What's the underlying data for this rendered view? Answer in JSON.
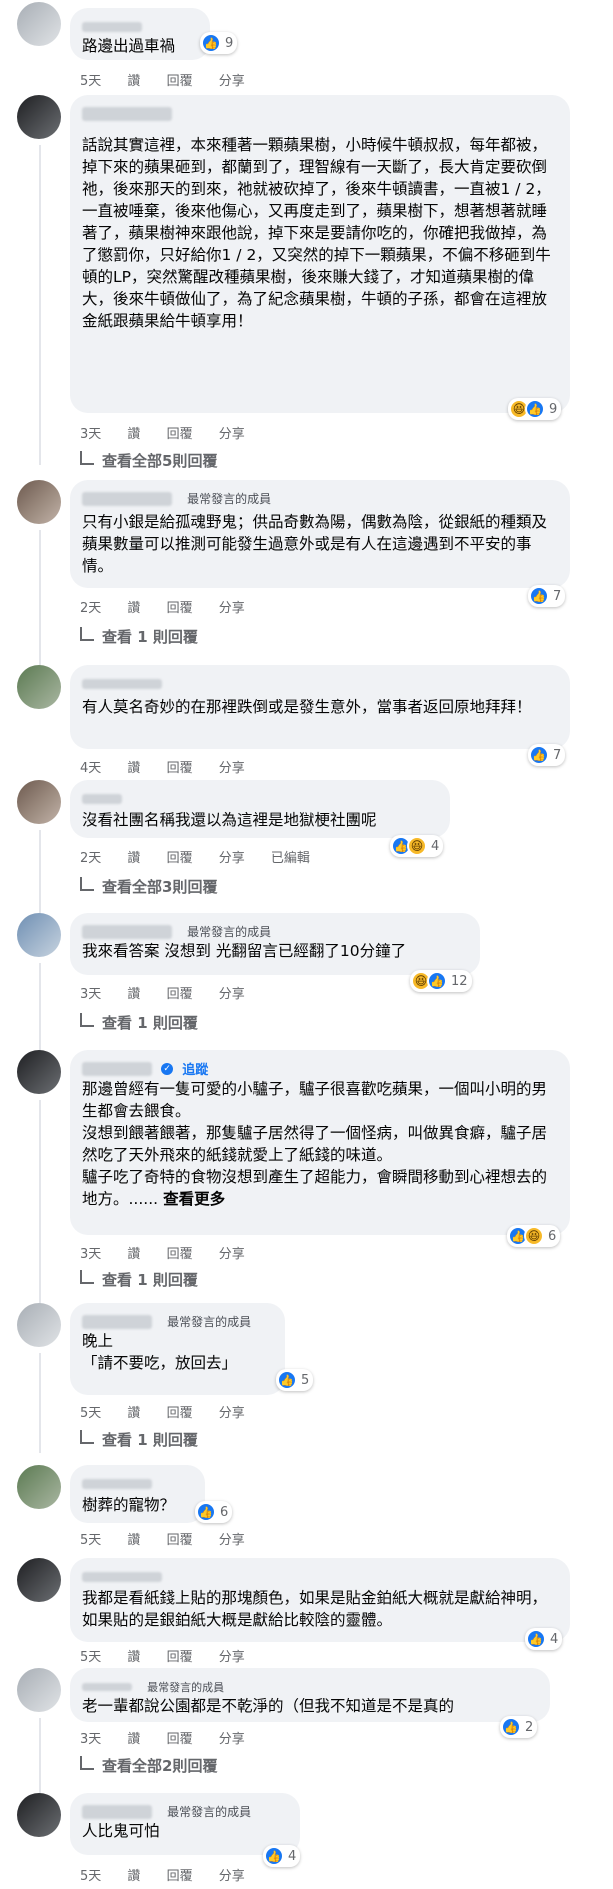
{
  "comments": [
    {
      "text": "路邊出過車禍",
      "reactions": "9",
      "time": "5天",
      "like": "讚",
      "reply": "回覆",
      "share": "分享"
    },
    {
      "text": "話說其實這裡，本來種著一顆蘋果樹，小時候牛頓叔叔，每年都被，掉下來的蘋果砸到，都蘭到了，理智線有一天斷了，長大肯定要砍倒祂，後來那天的到來，祂就被砍掉了，後來牛頓讀書，一直被1 / 2，一直被唾棄，後來他傷心，又再度走到了，蘋果樹下，想著想著就睡著了，蘋果樹神來跟他說，掉下來是要請你吃的，你確把我做掉，為了懲罰你，只好給你1 / 2，又突然的掉下一顆蘋果，不偏不移砸到牛頓的LP，突然驚醒改種蘋果樹，後來賺大錢了，才知道蘋果樹的偉大，後來牛頓做仙了，為了紀念蘋果樹，牛頓的子孫，都會在這裡放金紙跟蘋果給牛頓享用！",
      "reactions": "9",
      "time": "3天",
      "like": "讚",
      "reply": "回覆",
      "share": "分享",
      "replies": "查看全部5則回覆"
    },
    {
      "badge": "最常發言的成員",
      "text": "只有小銀是給孤魂野鬼；供品奇數為陽，偶數為陰，從銀紙的種類及蘋果數量可以推測可能發生過意外或是有人在這邊遇到不平安的事情。",
      "reactions": "7",
      "time": "2天",
      "like": "讚",
      "reply": "回覆",
      "share": "分享",
      "replies": "查看 1 則回覆"
    },
    {
      "text": "有人莫名奇妙的在那裡跌倒或是發生意外，當事者返回原地拜拜！",
      "reactions": "7",
      "time": "4天",
      "like": "讚",
      "reply": "回覆",
      "share": "分享"
    },
    {
      "text": "沒看社團名稱我還以為這裡是地獄梗社團呢",
      "reactions": "4",
      "time": "2天",
      "like": "讚",
      "reply": "回覆",
      "share": "分享",
      "edited": "已編輯",
      "replies": "查看全部3則回覆"
    },
    {
      "badge": "最常發言的成員",
      "text": "我來看答案 沒想到 光翻留言已經翻了10分鐘了",
      "reactions": "12",
      "time": "3天",
      "like": "讚",
      "reply": "回覆",
      "share": "分享",
      "replies": "查看 1 則回覆"
    },
    {
      "follow": "追蹤",
      "text1": "那邊曾經有一隻可愛的小驢子，驢子很喜歡吃蘋果，一個叫小明的男生都會去餵食。",
      "text2": "沒想到餵著餵著，那隻驢子居然得了一個怪病，叫做異食癖，驢子居然吃了天外飛來的紙錢就愛上了紙錢的味道。",
      "text3": "驢子吃了奇特的食物沒想到產生了超能力，會瞬間移動到心裡想去的地方。......",
      "see_more": "查看更多",
      "reactions": "6",
      "time": "3天",
      "like": "讚",
      "reply": "回覆",
      "share": "分享",
      "replies": "查看 1 則回覆"
    },
    {
      "badge": "最常發言的成員",
      "text1": "晚上",
      "text2": "「請不要吃，放回去」",
      "reactions": "5",
      "time": "5天",
      "like": "讚",
      "reply": "回覆",
      "share": "分享",
      "replies": "查看 1 則回覆"
    },
    {
      "text": "樹葬的寵物？",
      "reactions": "6",
      "time": "5天",
      "like": "讚",
      "reply": "回覆",
      "share": "分享"
    },
    {
      "text": "我都是看紙錢上貼的那塊顏色，如果是貼金鉑紙大概就是獻給神明，如果貼的是銀鉑紙大概是獻給比較陰的靈體。",
      "reactions": "4",
      "time": "5天",
      "like": "讚",
      "reply": "回覆",
      "share": "分享"
    },
    {
      "badge": "最常發言的成員",
      "text": "老一輩都說公園都是不乾淨的（但我不知道是不是真的",
      "reactions": "2",
      "time": "3天",
      "like": "讚",
      "reply": "回覆",
      "share": "分享",
      "replies": "查看全部2則回覆"
    },
    {
      "badge": "最常發言的成員",
      "text": "人比鬼可怕",
      "reactions": "4",
      "time": "5天",
      "like": "讚",
      "reply": "回覆",
      "share": "分享"
    }
  ]
}
